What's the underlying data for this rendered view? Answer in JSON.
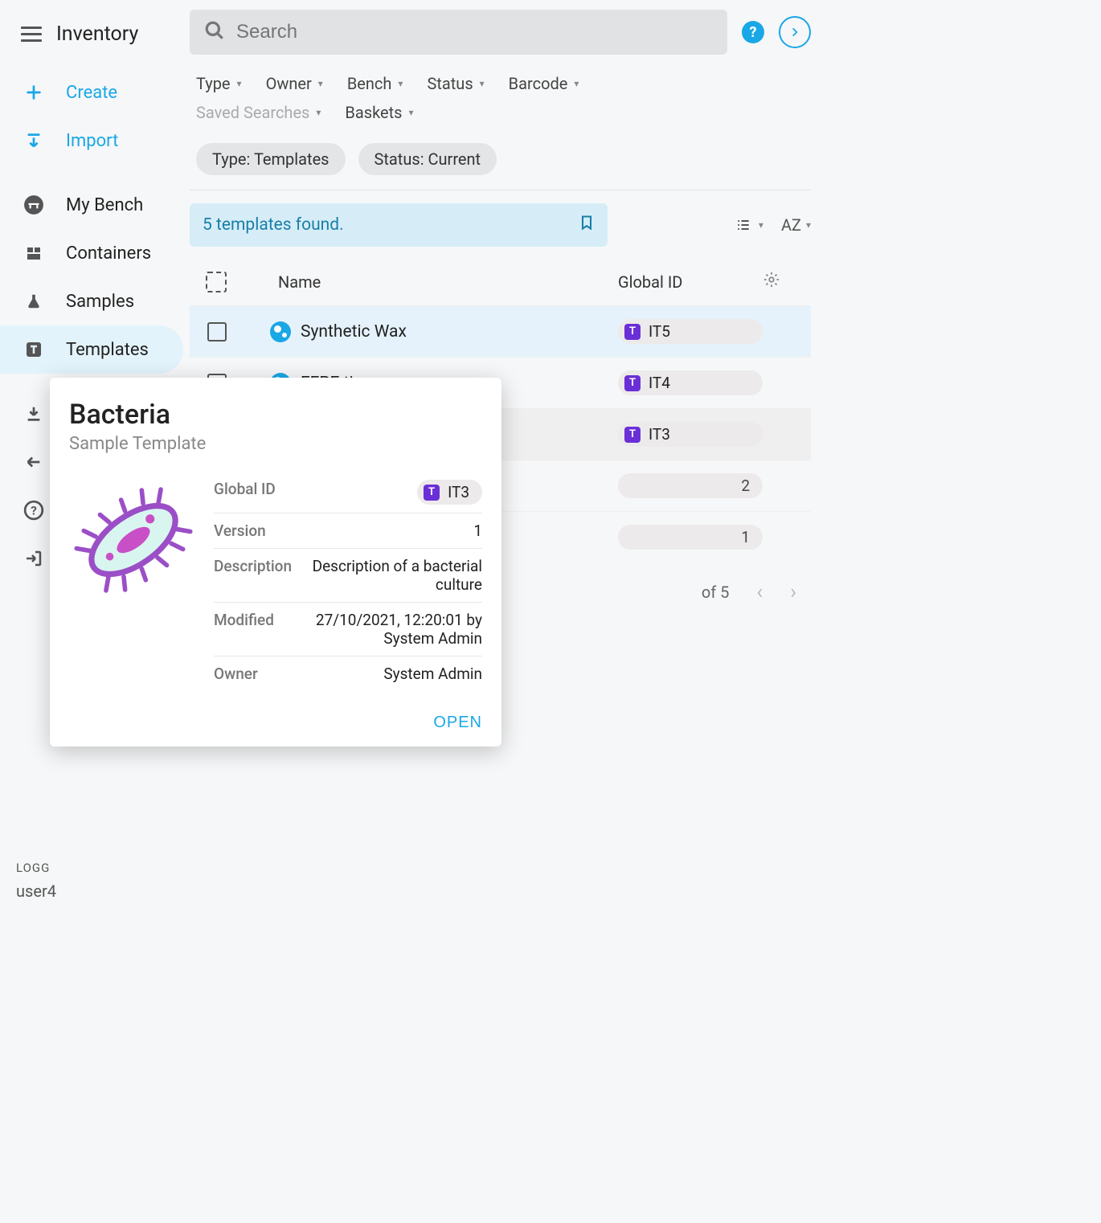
{
  "header": {
    "title": "Inventory"
  },
  "search": {
    "placeholder": "Search"
  },
  "sidebar": {
    "create": "Create",
    "import": "Import",
    "mybench": "My Bench",
    "containers": "Containers",
    "samples": "Samples",
    "templates": "Templates",
    "export": "Export Data"
  },
  "logged": {
    "label": "LOGG",
    "user": "user4"
  },
  "filters": {
    "type": "Type",
    "owner": "Owner",
    "bench": "Bench",
    "status": "Status",
    "barcode": "Barcode",
    "saved": "Saved Searches",
    "baskets": "Baskets"
  },
  "chips": {
    "type": "Type: Templates",
    "status": "Status: Current"
  },
  "results": {
    "found": "5 templates found.",
    "sort": "AZ"
  },
  "columns": {
    "name": "Name",
    "gid": "Global ID"
  },
  "rows": [
    {
      "name": "Synthetic Wax",
      "id": "IT5"
    },
    {
      "name": "FFPE tissue",
      "id": "IT4"
    },
    {
      "name": "Bacteria",
      "id": "IT3"
    },
    {
      "name": "",
      "id": "2"
    },
    {
      "name": "",
      "id": "1"
    }
  ],
  "pager": {
    "range": "of 5"
  },
  "popover": {
    "title": "Bacteria",
    "subtitle": "Sample Template",
    "fields": {
      "gid_label": "Global ID",
      "gid_value": "IT3",
      "ver_label": "Version",
      "ver_value": "1",
      "desc_label": "Description",
      "desc_value": "Description of a bacterial culture",
      "mod_label": "Modified",
      "mod_value": "27/10/2021, 12:20:01 by System Admin",
      "own_label": "Owner",
      "own_value": "System Admin"
    },
    "open": "OPEN"
  }
}
